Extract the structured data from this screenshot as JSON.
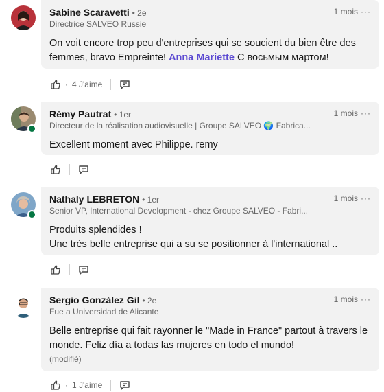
{
  "comments": [
    {
      "name": "Sabine Scaravetti",
      "degree": "• 2e",
      "headline": "Directrice SALVEO Russie",
      "time": "1 mois",
      "menu": "···",
      "text_before": "On voit encore trop peu d'entreprises qui se soucient du bien être des femmes, bravo Empreinte! ",
      "mention": "Anna Mariette",
      "text_after": " С восьмым мартом!",
      "reactions_sep": "·",
      "reactions": "4 J'aime"
    },
    {
      "name": "Rémy Pautrat",
      "degree": "• 1er",
      "headline": "Directeur de la réalisation audiovisuelle | Groupe SALVEO 🌍 Fabrica...",
      "time": "1 mois",
      "menu": "···",
      "text": "Excellent moment avec Philippe. remy"
    },
    {
      "name": "Nathaly LEBRETON",
      "degree": "• 1er",
      "headline": "Senior VP, International Development - chez Groupe SALVEO - Fabri...",
      "time": "1 mois",
      "menu": "···",
      "line1": "Produits splendides !",
      "line2": "Une très belle entreprise qui a su se positionner à l'international .."
    },
    {
      "name": "Sergio González Gil",
      "degree": "• 2e",
      "headline": "Fue a Universidad de Alicante",
      "time": "1 mois",
      "menu": "···",
      "text": "Belle entreprise qui fait rayonner le \"Made in France\" partout à travers le monde. Feliz día a todas las mujeres en todo el mundo!",
      "edited": "(modifié)",
      "reactions_sep": "·",
      "reactions": "1 J'aime"
    }
  ],
  "icons": {
    "like": "like-icon",
    "reply": "reply-icon",
    "presence": "online-presence-indicator"
  },
  "colors": {
    "bubble": "#f2f2f2",
    "mention": "#5c4ad2",
    "presence": "#057642"
  }
}
